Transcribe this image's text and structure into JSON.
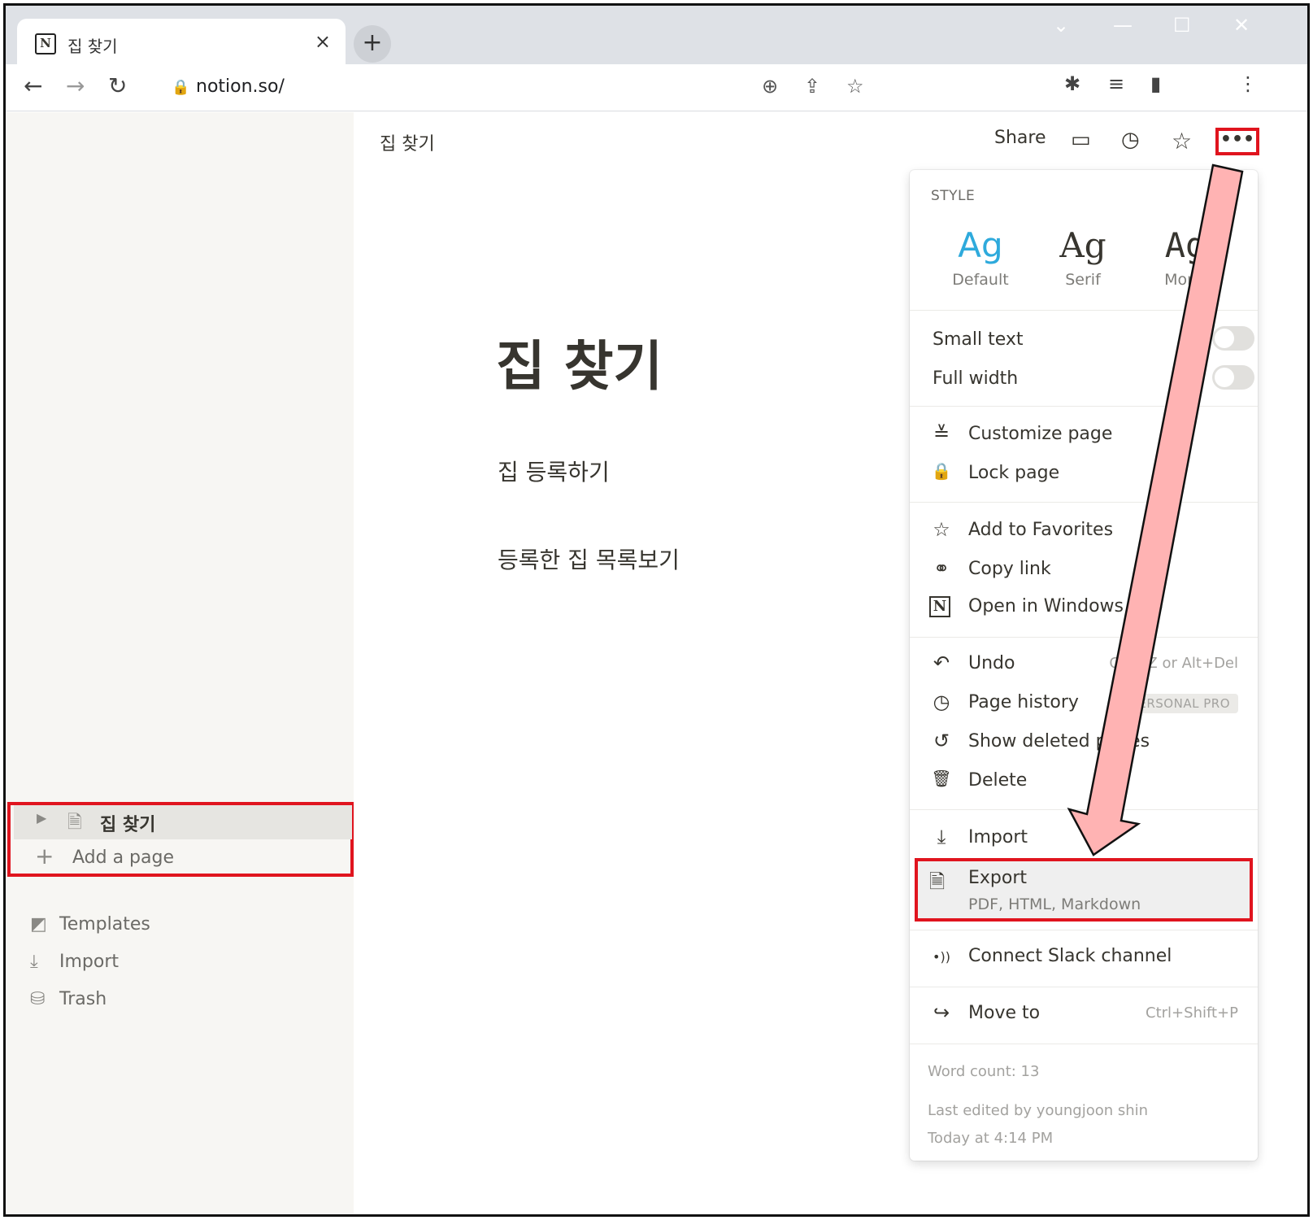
{
  "browser": {
    "tab_title": "집 찾기",
    "tab_close": "×",
    "new_tab": "+",
    "window_controls": [
      "⌄",
      "—",
      "☐",
      "✕"
    ],
    "url": "notion.so/",
    "nav": {
      "back": "←",
      "forward": "→",
      "reload": "↻"
    },
    "lock_icon": "🔒",
    "omnibox_icons": [
      "⊕",
      "⇪",
      "☆"
    ],
    "extension_icons": [
      "✱",
      "≡",
      "▮",
      "⋮"
    ]
  },
  "topbar": {
    "breadcrumb": "집 찾기",
    "share": "Share",
    "icons": [
      "▭",
      "◷",
      "☆"
    ],
    "more": "•••"
  },
  "page": {
    "title": "집 찾기",
    "links": [
      "집 등록하기",
      "등록한 집 목록보기"
    ]
  },
  "sidebar": {
    "tree": {
      "expand": "▶",
      "page_icon": "🗎",
      "page_label": "집 찾기",
      "add_icon": "+",
      "add_label": "Add a page"
    },
    "items": [
      {
        "icon": "◩",
        "label": "Templates"
      },
      {
        "icon": "⤓",
        "label": "Import"
      },
      {
        "icon": "⛁",
        "label": "Trash"
      }
    ]
  },
  "menu": {
    "style_label": "STYLE",
    "styles": [
      {
        "glyph": "Ag",
        "label": "Default",
        "color": "#2eaadc"
      },
      {
        "glyph": "Ag",
        "label": "Serif",
        "color": "#37352f"
      },
      {
        "glyph": "Ag",
        "label": "Mono",
        "color": "#37352f"
      }
    ],
    "toggles": [
      {
        "label": "Small text",
        "on": false
      },
      {
        "label": "Full width",
        "on": false
      }
    ],
    "group1": [
      {
        "icon": "≚",
        "label": "Customize page"
      },
      {
        "icon": "🔒",
        "label": "Lock page"
      }
    ],
    "group2": [
      {
        "icon": "☆",
        "label": "Add to Favorites"
      },
      {
        "icon": "⚭",
        "label": "Copy link"
      },
      {
        "icon": "N",
        "label": "Open in Windows app"
      }
    ],
    "group3": [
      {
        "icon": "↶",
        "label": "Undo",
        "shortcut": "Ctrl+Z or Alt+Del"
      },
      {
        "icon": "◷",
        "label": "Page history",
        "badge": "PERSONAL PRO"
      },
      {
        "icon": "↺",
        "label": "Show deleted pages"
      },
      {
        "icon": "🗑",
        "label": "Delete"
      }
    ],
    "import": {
      "icon": "⤓",
      "label": "Import"
    },
    "export": {
      "icon": "🗎",
      "label": "Export",
      "sub": "PDF, HTML, Markdown"
    },
    "slack": {
      "icon": "•))",
      "label": "Connect Slack channel"
    },
    "move": {
      "icon": "↪",
      "label": "Move to",
      "shortcut": "Ctrl+Shift+P"
    },
    "footer": {
      "word_count": "Word count: 13",
      "last_edited": "Last edited by youngjoon shin",
      "edited_time": "Today at 4:14 PM"
    }
  },
  "colors": {
    "highlight": "#e0141e",
    "arrow_fill": "#ffb3b3",
    "accent": "#2eaadc"
  }
}
